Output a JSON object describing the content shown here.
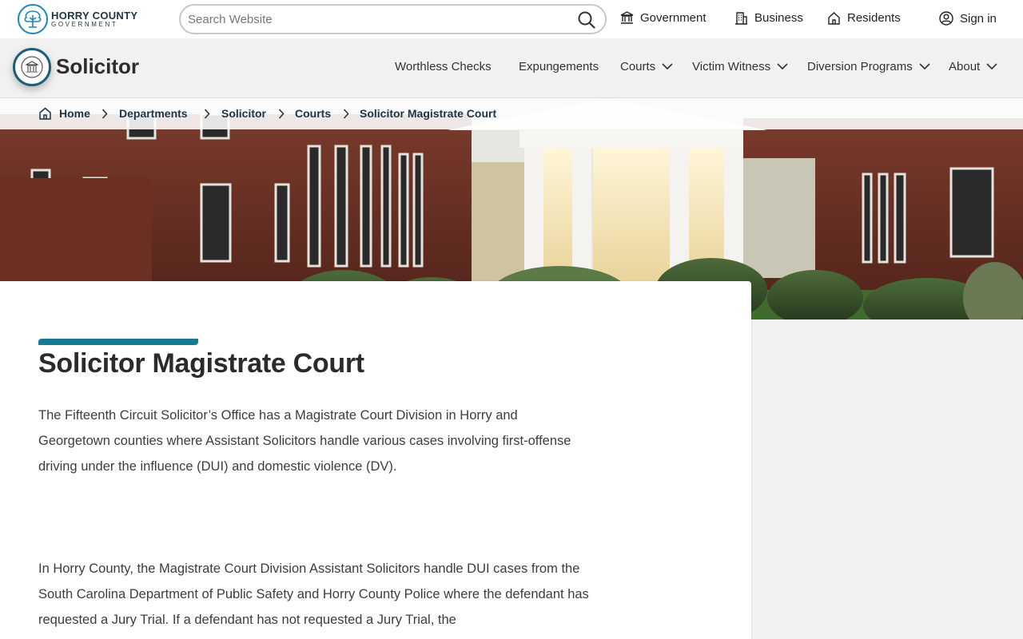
{
  "site": {
    "logo_name": "HORRY COUNTY",
    "logo_sub": "GOVERNMENT"
  },
  "search": {
    "placeholder": "Search Website"
  },
  "top_nav": {
    "government": "Government",
    "business": "Business",
    "residents": "Residents",
    "sign_in": "Sign in"
  },
  "department": {
    "title": "Solicitor",
    "nav": {
      "worthless_checks": "Worthless Checks",
      "expungements": "Expungements",
      "courts": "Courts",
      "victim_witness": "Victim Witness",
      "diversion_programs": "Diversion Programs",
      "about": "About"
    }
  },
  "breadcrumb": {
    "home": "Home",
    "departments": "Departments",
    "solicitor": "Solicitor",
    "courts": "Courts",
    "current": "Solicitor Magistrate Court"
  },
  "main": {
    "title": "Solicitor Magistrate Court",
    "para1": "The Fifteenth Circuit Solicitor’s Office has a Magistrate Court Division in Horry and Georgetown counties where Assistant Solicitors handle various cases involving first-offense driving under the influence (DUI) and domestic violence (DV).",
    "para2": "In Horry County, the Magistrate Court Division Assistant Solicitors handle DUI cases from the South Carolina Department of Public Safety and Horry County Police where the defendant has requested a Jury Trial. If a defendant has not requested a Jury Trial, the"
  },
  "colors": {
    "accent": "#157a94",
    "brand_dark": "#1f3344",
    "seal_ring": "#1d5f76"
  }
}
